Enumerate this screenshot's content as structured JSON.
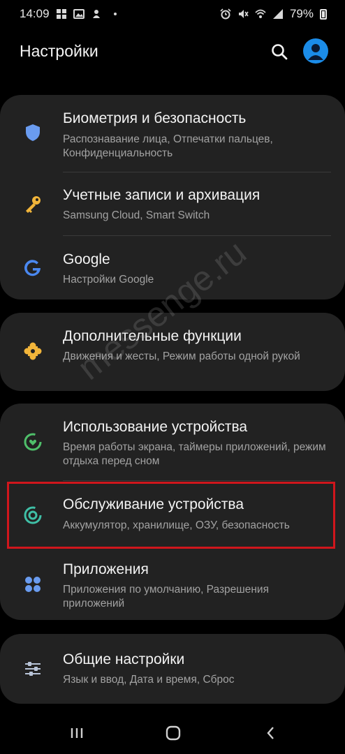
{
  "status_bar": {
    "time": "14:09",
    "battery": "79%",
    "left_icons": [
      "gallery-grid-icon",
      "image-icon",
      "notification-icon",
      "more-dot-icon"
    ],
    "right_icons": [
      "alarm-icon",
      "mute-icon",
      "wifi-icon",
      "signal-icon",
      "battery-icon"
    ]
  },
  "header": {
    "title": "Настройки",
    "search_icon": "search-icon",
    "avatar_icon": "account-icon",
    "avatar_color": "#1b8ce8"
  },
  "settings": {
    "group1": [
      {
        "title": "Биометрия и безопасность",
        "subtitle": "Распознавание лица, Отпечатки пальцев, Конфиденциальность",
        "icon": "shield-icon",
        "icon_color": "#6a9cf0"
      },
      {
        "title": "Учетные записи и архивация",
        "subtitle": "Samsung Cloud, Smart Switch",
        "icon": "key-icon",
        "icon_color": "#f2b53a"
      },
      {
        "title": "Google",
        "subtitle": "Настройки Google",
        "icon": "google-icon",
        "icon_color": "#4a88f0"
      }
    ],
    "group2": [
      {
        "title": "Дополнительные функции",
        "subtitle": "Движения и жесты, Режим работы одной рукой",
        "icon": "puzzle-icon",
        "icon_color": "#f2b53a"
      }
    ],
    "group3": [
      {
        "title": "Использование устройства",
        "subtitle": "Время работы экрана, таймеры приложений, режим отдыха перед сном",
        "icon": "wellbeing-icon",
        "icon_color": "#4fbf6a"
      },
      {
        "title": "Обслуживание устройства",
        "subtitle": "Аккумулятор, хранилище, ОЗУ, безопасность",
        "icon": "device-care-icon",
        "icon_color": "#3fbfa6"
      },
      {
        "title": "Приложения",
        "subtitle": "Приложения по умолчанию, Разрешения приложений",
        "icon": "apps-icon",
        "icon_color": "#6a9cf0"
      }
    ],
    "group4": [
      {
        "title": "Общие настройки",
        "subtitle": "Язык и ввод, Дата и время, Сброс",
        "icon": "sliders-icon",
        "icon_color": "#b8c4d8"
      }
    ]
  },
  "highlight_color": "#d0161c",
  "watermark": "messenge.ru",
  "navbar": {
    "recent_icon": "recent-apps-icon",
    "home_icon": "home-icon",
    "back_icon": "back-icon"
  }
}
